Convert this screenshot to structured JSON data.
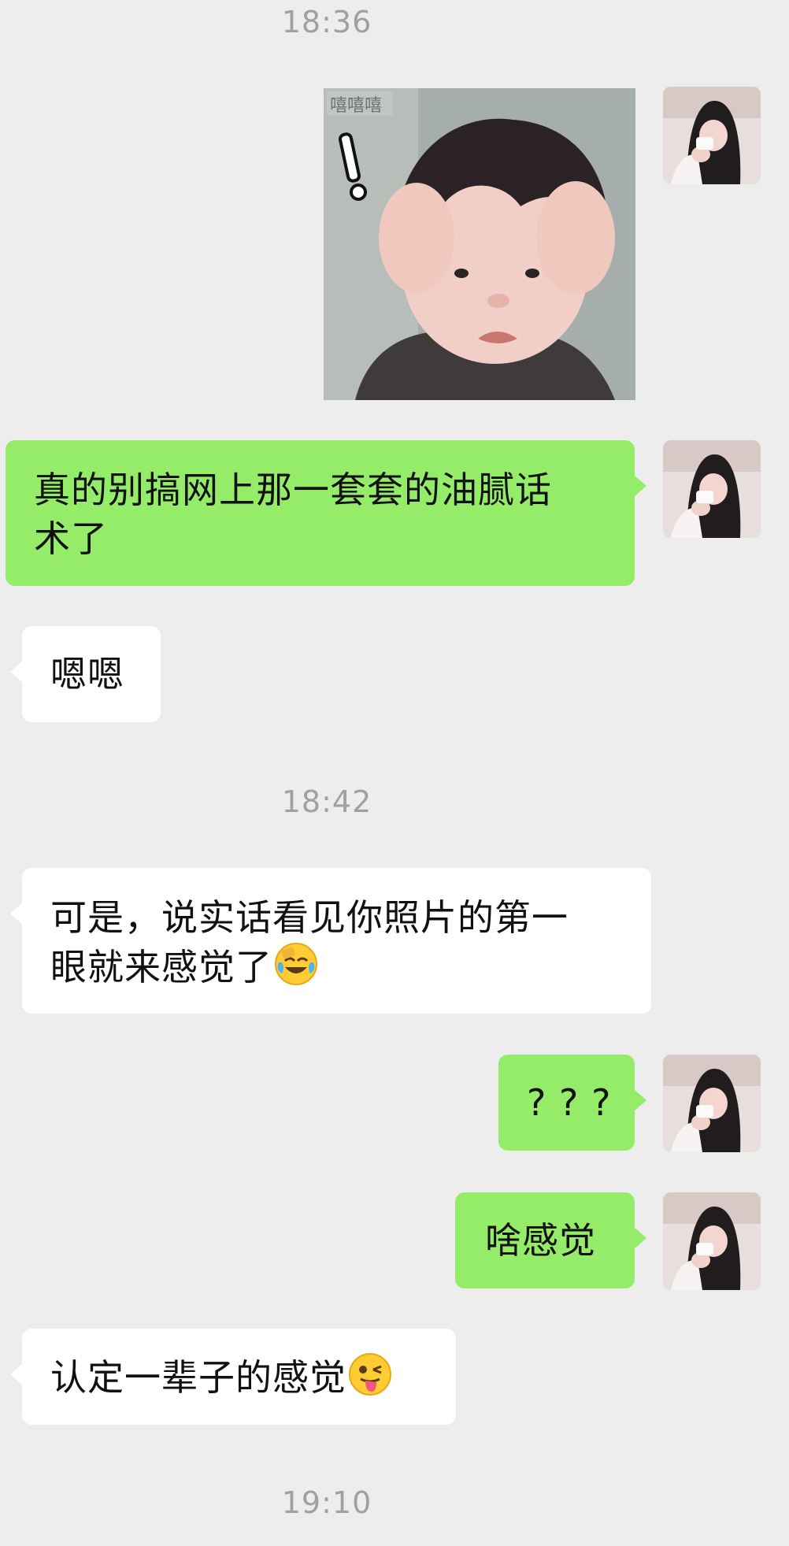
{
  "chat": {
    "timestamps": [
      "18:36",
      "18:42",
      "19:10"
    ],
    "sticker": {
      "watermark": "嘻嘻嘻",
      "icon": "baby-headache-sticker"
    },
    "messages": [
      {
        "sender": "me",
        "text": "真的别搞网上那一套套的油腻话",
        "text2": "术了"
      },
      {
        "sender": "other",
        "text": "嗯嗯"
      },
      {
        "sender": "other",
        "text": "可是，说实话看见你照片的第一",
        "text2": "眼就来感觉了",
        "emoji": "face-with-tears-of-joy-icon"
      },
      {
        "sender": "me",
        "text": "? ? ?"
      },
      {
        "sender": "me",
        "text": "啥感觉"
      },
      {
        "sender": "other",
        "text": "认定一辈子的感觉",
        "emoji": "winking-face-with-tongue-icon"
      }
    ]
  },
  "colors": {
    "background": "#ededed",
    "my_bubble": "#95ec69",
    "other_bubble": "#ffffff",
    "timestamp_text": "#a0a0a0"
  }
}
